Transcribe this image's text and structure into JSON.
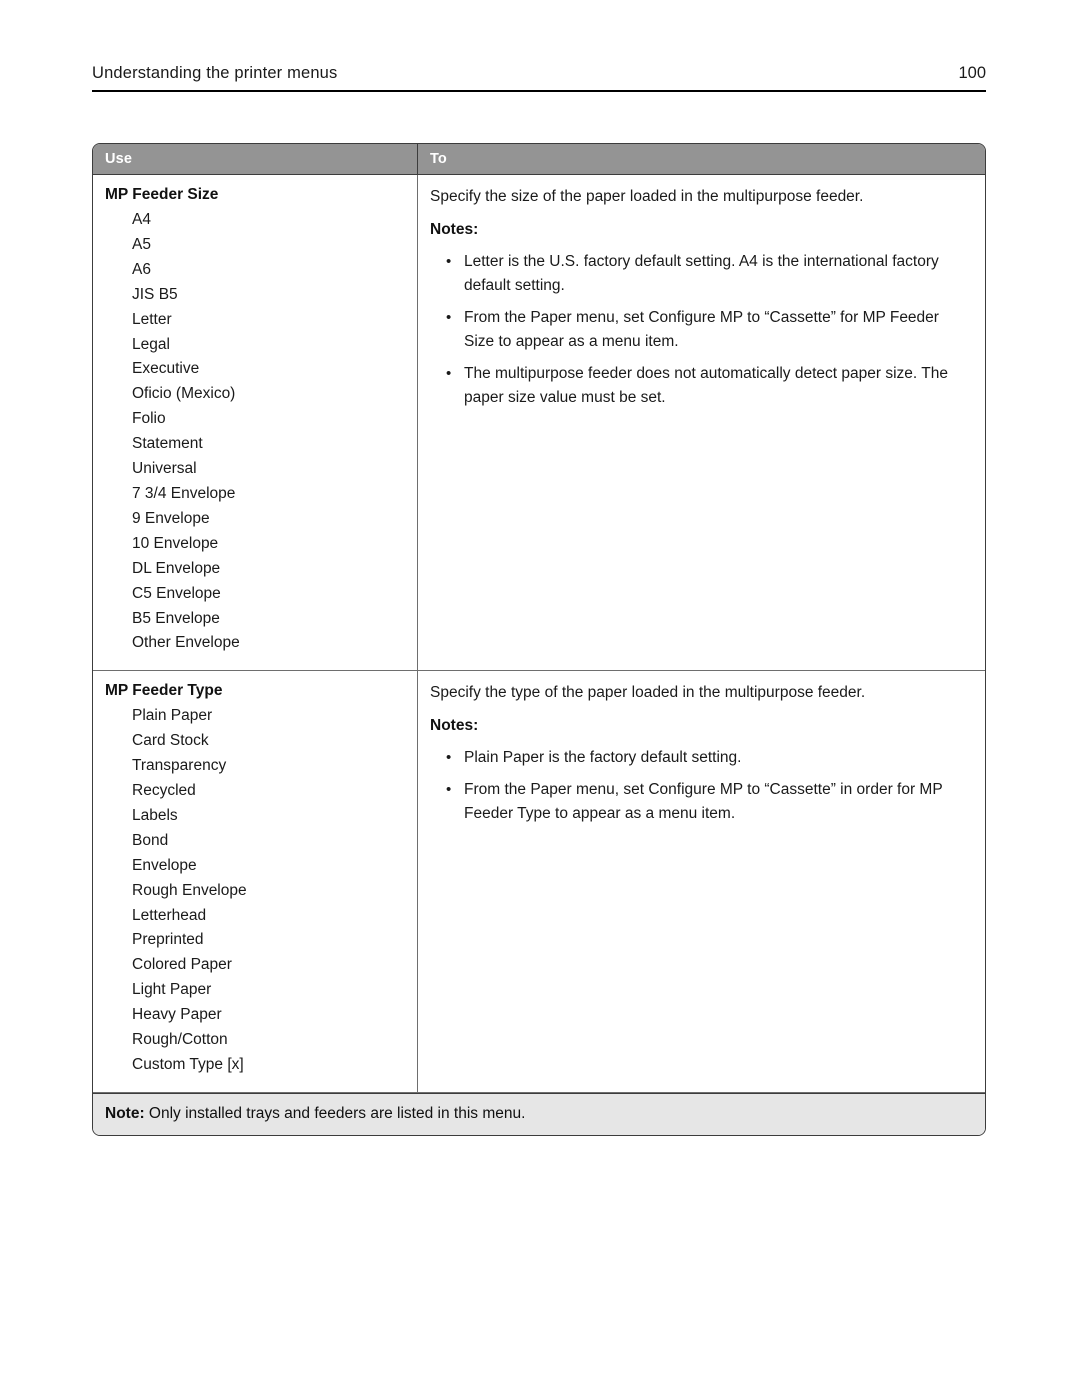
{
  "header": {
    "title": "Understanding the printer menus",
    "page_number": "100"
  },
  "table": {
    "columns": {
      "use": "Use",
      "to": "To"
    },
    "rows": [
      {
        "setting": "MP Feeder Size",
        "options": [
          "A4",
          "A5",
          "A6",
          "JIS B5",
          "Letter",
          "Legal",
          "Executive",
          "Oficio (Mexico)",
          "Folio",
          "Statement",
          "Universal",
          "7 3/4 Envelope",
          "9 Envelope",
          "10 Envelope",
          "DL Envelope",
          "C5 Envelope",
          "B5 Envelope",
          "Other Envelope"
        ],
        "description": "Specify the size of the paper loaded in the multipurpose feeder.",
        "notes_label": "Notes:",
        "notes": [
          "Letter is the U.S. factory default setting. A4 is the international factory default setting.",
          "From the Paper menu, set Configure MP to “Cassette” for MP Feeder Size to appear as a menu item.",
          "The multipurpose feeder does not automatically detect paper size. The paper size value must be set."
        ]
      },
      {
        "setting": "MP Feeder Type",
        "options": [
          "Plain Paper",
          "Card Stock",
          "Transparency",
          "Recycled",
          "Labels",
          "Bond",
          "Envelope",
          "Rough Envelope",
          "Letterhead",
          "Preprinted",
          "Colored Paper",
          "Light Paper",
          "Heavy Paper",
          "Rough/Cotton",
          "Custom Type [x]"
        ],
        "description": "Specify the type of the paper loaded in the multipurpose feeder.",
        "notes_label": "Notes:",
        "notes": [
          "Plain Paper is the factory default setting.",
          "From the Paper menu, set Configure MP to “Cassette” in order for MP Feeder Type to appear as a menu item."
        ]
      }
    ],
    "footer_note": {
      "prefix": "Note:",
      "text": " Only installed trays and feeders are listed in this menu."
    }
  },
  "bullet_glyph": "•",
  "colors": {
    "header_row_bg": "#949494",
    "footer_note_bg": "#e6e6e6",
    "border": "#3c3c3c",
    "text": "#1a1a1a"
  }
}
